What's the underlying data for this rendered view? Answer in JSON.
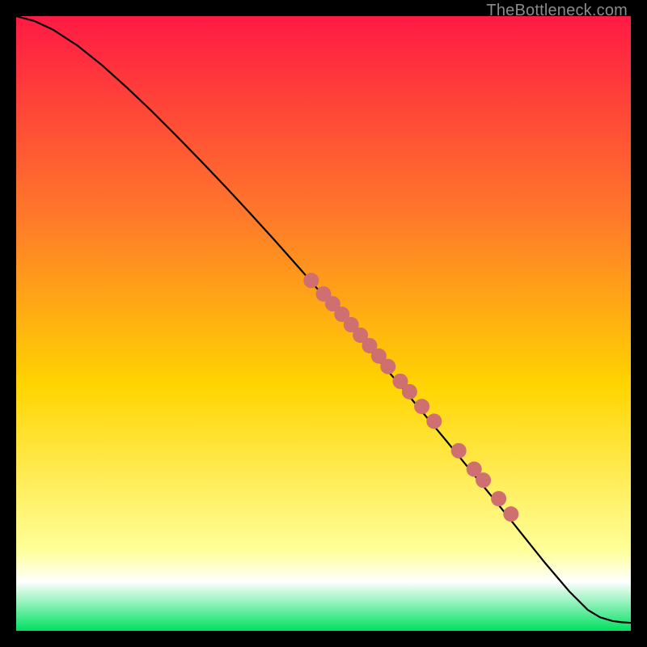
{
  "watermark": "TheBottleneck.com",
  "colors": {
    "gradient_top": "#ff1a44",
    "gradient_mid_upper": "#ff7a2a",
    "gradient_mid": "#ffd400",
    "gradient_pale": "#ffff9a",
    "gradient_white": "#ffffff",
    "gradient_bottom": "#00e060",
    "line": "#000000",
    "marker_fill": "#cf6f6f",
    "marker_stroke": "#b84f4f",
    "frame": "#000000"
  },
  "chart_data": {
    "type": "line",
    "title": "",
    "xlabel": "",
    "ylabel": "",
    "xlim": [
      0,
      100
    ],
    "ylim": [
      0,
      100
    ],
    "grid": false,
    "legend": false,
    "series": [
      {
        "name": "curve",
        "x": [
          0,
          3,
          6,
          10,
          14,
          18,
          22,
          26,
          30,
          34,
          38,
          42,
          46,
          50,
          54,
          58,
          62,
          66,
          70,
          74,
          78,
          82,
          86,
          90,
          93,
          95,
          97,
          98.5,
          100
        ],
        "y": [
          100,
          99.2,
          97.8,
          95.2,
          92.0,
          88.4,
          84.6,
          80.6,
          76.5,
          72.3,
          68.0,
          63.6,
          59.1,
          54.5,
          49.9,
          45.2,
          40.5,
          35.7,
          30.9,
          26.0,
          21.1,
          16.1,
          11.1,
          6.4,
          3.4,
          2.2,
          1.6,
          1.4,
          1.3
        ]
      }
    ],
    "markers": [
      {
        "x": 48.0,
        "y": 57.0
      },
      {
        "x": 50.0,
        "y": 54.8
      },
      {
        "x": 51.5,
        "y": 53.2
      },
      {
        "x": 53.0,
        "y": 51.5
      },
      {
        "x": 54.5,
        "y": 49.8
      },
      {
        "x": 56.0,
        "y": 48.1
      },
      {
        "x": 57.5,
        "y": 46.4
      },
      {
        "x": 59.0,
        "y": 44.7
      },
      {
        "x": 60.5,
        "y": 43.0
      },
      {
        "x": 62.5,
        "y": 40.6
      },
      {
        "x": 64.0,
        "y": 38.9
      },
      {
        "x": 66.0,
        "y": 36.5
      },
      {
        "x": 68.0,
        "y": 34.1
      },
      {
        "x": 72.0,
        "y": 29.3
      },
      {
        "x": 74.5,
        "y": 26.3
      },
      {
        "x": 76.0,
        "y": 24.5
      },
      {
        "x": 78.5,
        "y": 21.5
      },
      {
        "x": 80.5,
        "y": 19.0
      }
    ],
    "gradient_stops": [
      {
        "t": 0.0,
        "hint": "red"
      },
      {
        "t": 0.33,
        "hint": "orange"
      },
      {
        "t": 0.6,
        "hint": "yellow"
      },
      {
        "t": 0.87,
        "hint": "pale-yellow"
      },
      {
        "t": 0.92,
        "hint": "white"
      },
      {
        "t": 1.0,
        "hint": "green"
      }
    ]
  }
}
